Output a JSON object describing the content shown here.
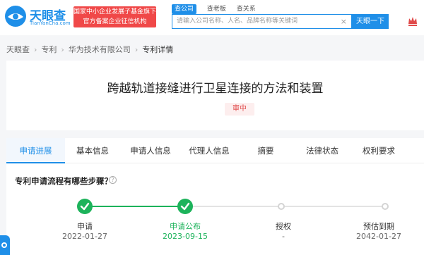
{
  "brand": {
    "name": "天眼查",
    "domain": "TianYanCha.com",
    "badge_line1": "国家中小企业发展子基金旗下",
    "badge_line2": "官方备案企业征信机构"
  },
  "search": {
    "tabs": [
      "查公司",
      "查老板",
      "查关系"
    ],
    "placeholder": "请输入公司名称、人名、品牌名称等关键词",
    "clear": "×",
    "button": "天眼一下"
  },
  "breadcrumb": [
    "天眼查",
    "专利",
    "华为技术有限公司",
    "专利详情"
  ],
  "breadcrumb_sep": "›",
  "patent": {
    "title": "跨越轨道接缝进行卫星连接的方法和装置",
    "status": "审中"
  },
  "tabs": [
    "申请进展",
    "基本信息",
    "申请人信息",
    "代理人信息",
    "摘要",
    "法律状态",
    "权利要求"
  ],
  "progress": {
    "title": "专利申请流程有哪些步骤？",
    "help": "?",
    "steps": [
      {
        "label": "申请",
        "date": "2022-01-27",
        "done": true
      },
      {
        "label": "申请公布",
        "date": "2023-09-15",
        "done": true
      },
      {
        "label": "授权",
        "date": "-",
        "done": false
      },
      {
        "label": "预估到期",
        "date": "2042-01-27",
        "done": false
      }
    ]
  },
  "colors": {
    "brand": "#1f8fe8",
    "done": "#1db35b",
    "badge": "#f04848"
  }
}
